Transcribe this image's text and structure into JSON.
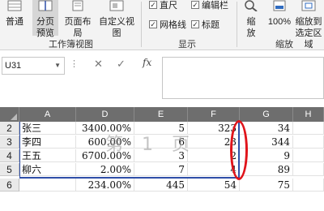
{
  "ribbon": {
    "workbook_views": {
      "normal": "普通",
      "page_break_preview": [
        "分页",
        "预览"
      ],
      "page_layout": "页面布局",
      "custom_views": "自定义视图",
      "group_label": "工作簿视图"
    },
    "show": {
      "ruler": "直尺",
      "formula_bar": "编辑栏",
      "gridlines": "网格线",
      "headings": "标题",
      "group_label": "显示"
    },
    "zoom": {
      "zoom": [
        "缩",
        "放"
      ],
      "zoom_100": "100%",
      "zoom_to_selection": [
        "缩放到",
        "选定区域"
      ],
      "group_label": "缩放"
    }
  },
  "formula_bar": {
    "name_box": "U31",
    "cancel_symbol": "✕",
    "enter_symbol": "✓",
    "fx_label": "fx",
    "content": ""
  },
  "sheet": {
    "columns": [
      "A",
      "D",
      "E",
      "F",
      "G",
      "H"
    ],
    "row_numbers": [
      "2",
      "3",
      "4",
      "5",
      "6"
    ],
    "rows": [
      [
        "张三",
        "3400.00%",
        "5",
        "323",
        "34",
        ""
      ],
      [
        "李四",
        "600.00%",
        "6",
        "23",
        "344",
        ""
      ],
      [
        "王五",
        "6700.00%",
        "3",
        "2",
        "9",
        ""
      ],
      [
        "柳六",
        "2.00%",
        "7",
        "4",
        "89",
        ""
      ],
      [
        "",
        "234.00%",
        "445",
        "54",
        "75",
        ""
      ]
    ],
    "page_watermark": "第 1 页"
  },
  "colors": {
    "page_break_line": "#2f4fa8",
    "annotation_ellipse": "#e0141b",
    "column_header_bg": "#6e6e6e"
  }
}
